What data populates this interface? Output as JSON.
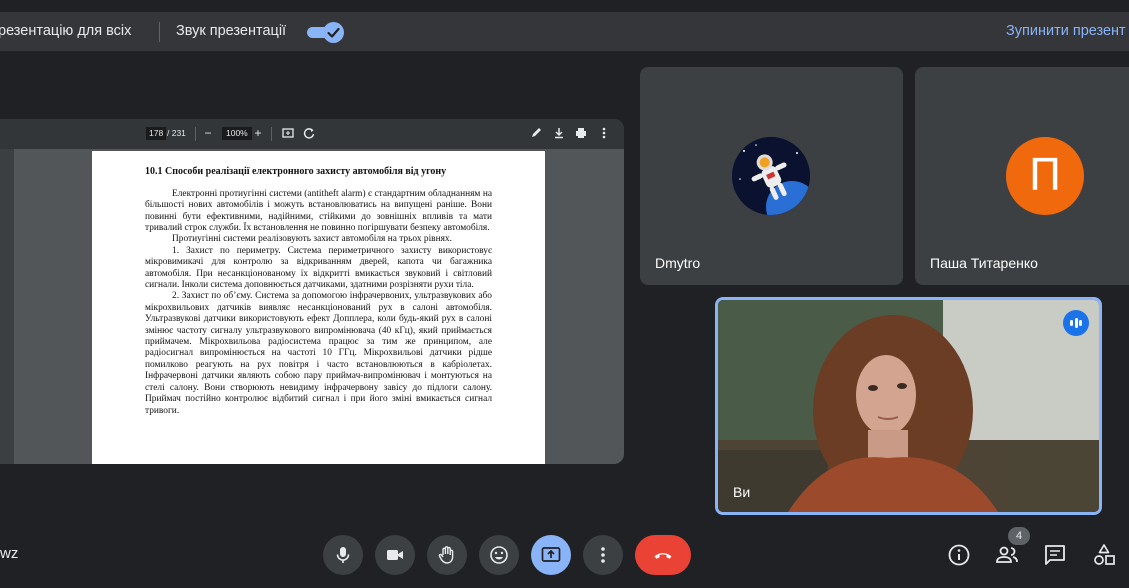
{
  "present_bar": {
    "show_for_all_label": "резентацію для всіх",
    "sound_label": "Звук презентації",
    "sound_enabled": true,
    "stop_label": "Зупинити презент"
  },
  "pdf": {
    "page_current": "178",
    "page_total": "/ 231",
    "zoom": "100%",
    "heading": "10.1 Способи реалізації електронного захисту автомобіля від угону",
    "paragraphs": [
      "Електронні протиугінні системи (antitheft alarm) є стандартним обладнанням на більшості нових автомобілів і можуть встановлюватись на випущені раніше. Вони повинні бути ефективними, надійними, стійкими до зовнішніх впливів та мати тривалий строк служби. Їх встановлення не повинно погіршувати безпеку автомобіля.",
      "Протиугінні системи реалізовують захист автомобіля на трьох рівнях.",
      "1. Захист по периметру. Система периметричного захисту використовує мікровимикачі для контролю за відкриванням дверей, капота чи багажника автомобіля. При несанкціонованому їх відкритті вмикається звуковий і світловий сигнали. Інколи система доповнюється датчиками, здатними розрізняти рухи тіла.",
      "2. Захист по об’єму. Система за допомогою інфрачервоних, ультразвукових або мікрохвильових датчиків виявляє несанкціонований рух в салоні автомобіля. Ультразвукові датчики використовують ефект Допплера, коли будь-який рух в салоні змінює частоту сигналу ультразвукового випромінювача (40 кГц), який приймається приймачем. Мікрохвильова радіосистема працює за тим же принципом, але радіосигнал випромінюється на частоті 10 ГГц. Мікрохвильові датчики рідше помилково реагують на рух повітря і часто встановлюються в кабріолетах. Інфрачервоні датчики являють собою пару приймач-випромінювач і монтуються на стелі салону. Вони створюють невидиму інфрачервону завісу до підлоги салону. Приймач постійно контролює відбитий сигнал і при його зміні вмикається сигнал тривоги."
    ]
  },
  "participants": [
    {
      "name": "Dmytro",
      "avatar": "astronaut-avatar"
    },
    {
      "name": "Паша Титаренко",
      "avatar_letter": "П",
      "avatar_color": "#f1690d"
    },
    {
      "name": "Ви",
      "speaking": true
    }
  ],
  "meeting": {
    "code_fragment": "wz",
    "participant_count": "4"
  },
  "colors": {
    "background": "#202124",
    "accent": "#8ab4f8",
    "leave": "#ea4335"
  }
}
